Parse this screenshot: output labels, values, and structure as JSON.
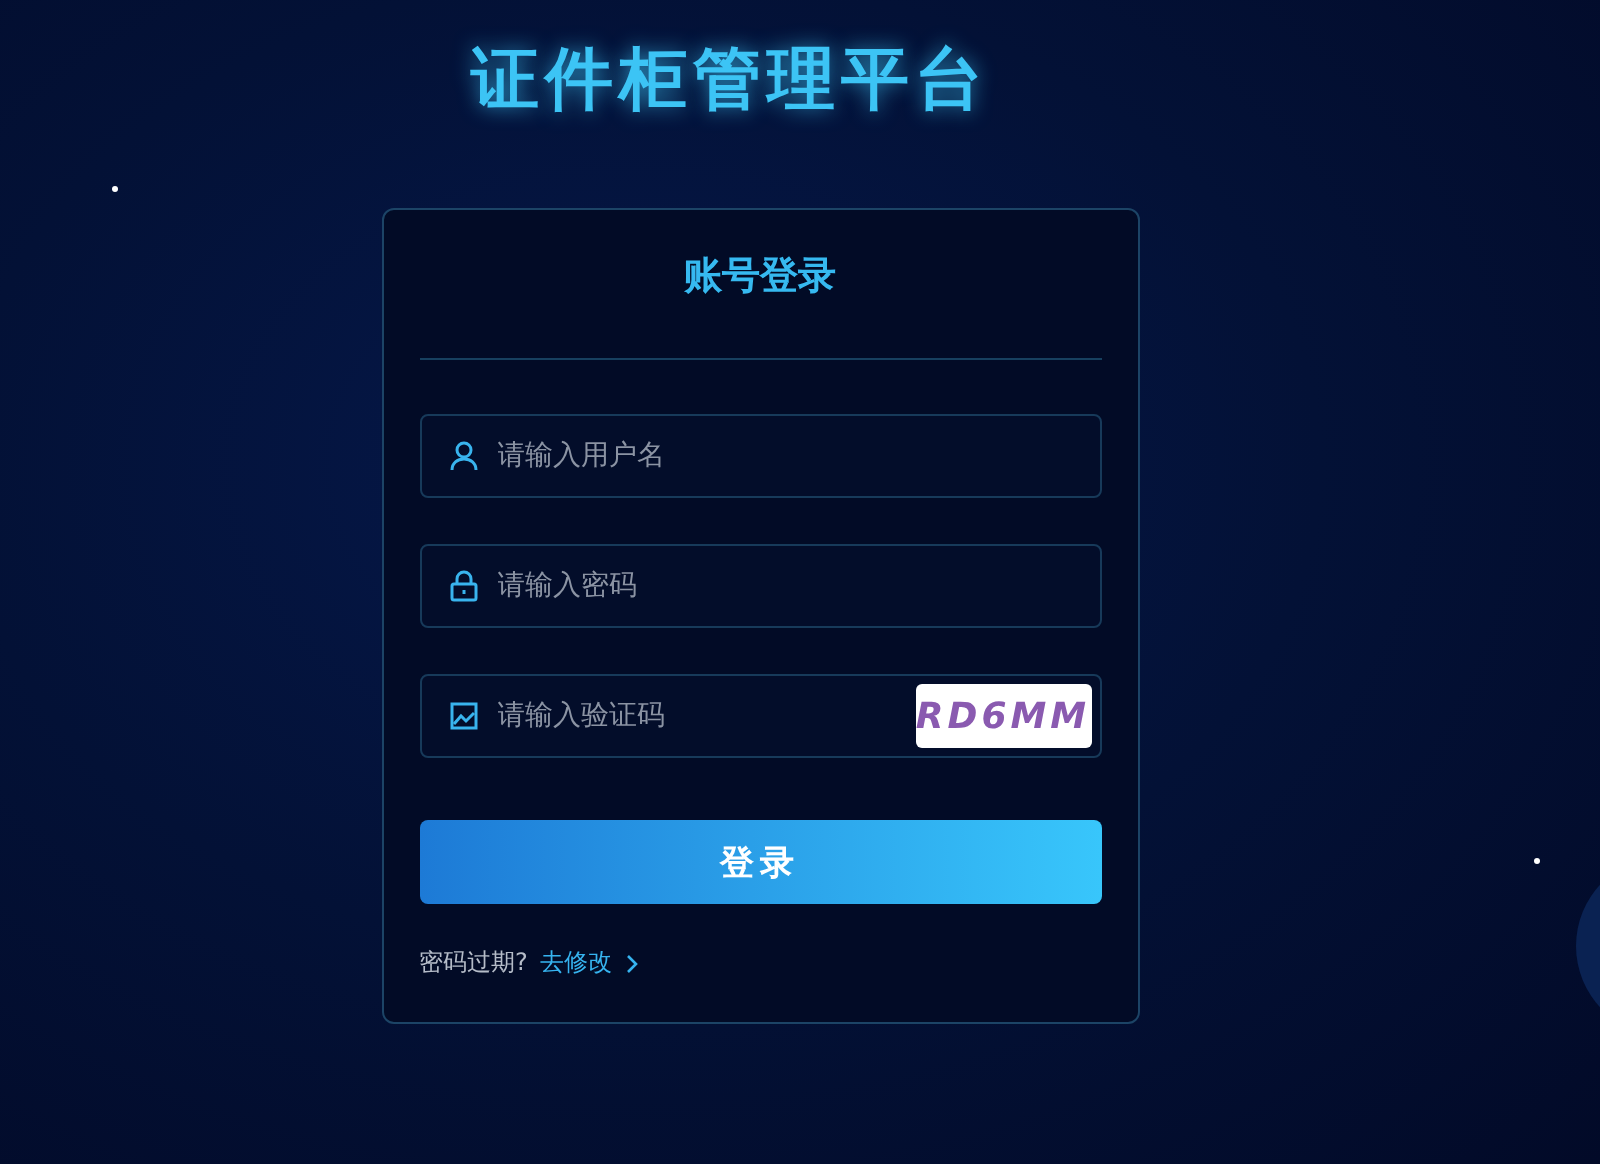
{
  "title": "证件柜管理平台",
  "card": {
    "heading": "账号登录",
    "fields": [
      {
        "kind": "user",
        "placeholder": "请输入用户名"
      },
      {
        "kind": "lock",
        "placeholder": "请输入密码"
      },
      {
        "kind": "image",
        "placeholder": "请输入验证码",
        "captcha": "RD6MM"
      }
    ],
    "submit": "登录",
    "footer": {
      "text": "密码过期?",
      "link": "去修改"
    }
  }
}
